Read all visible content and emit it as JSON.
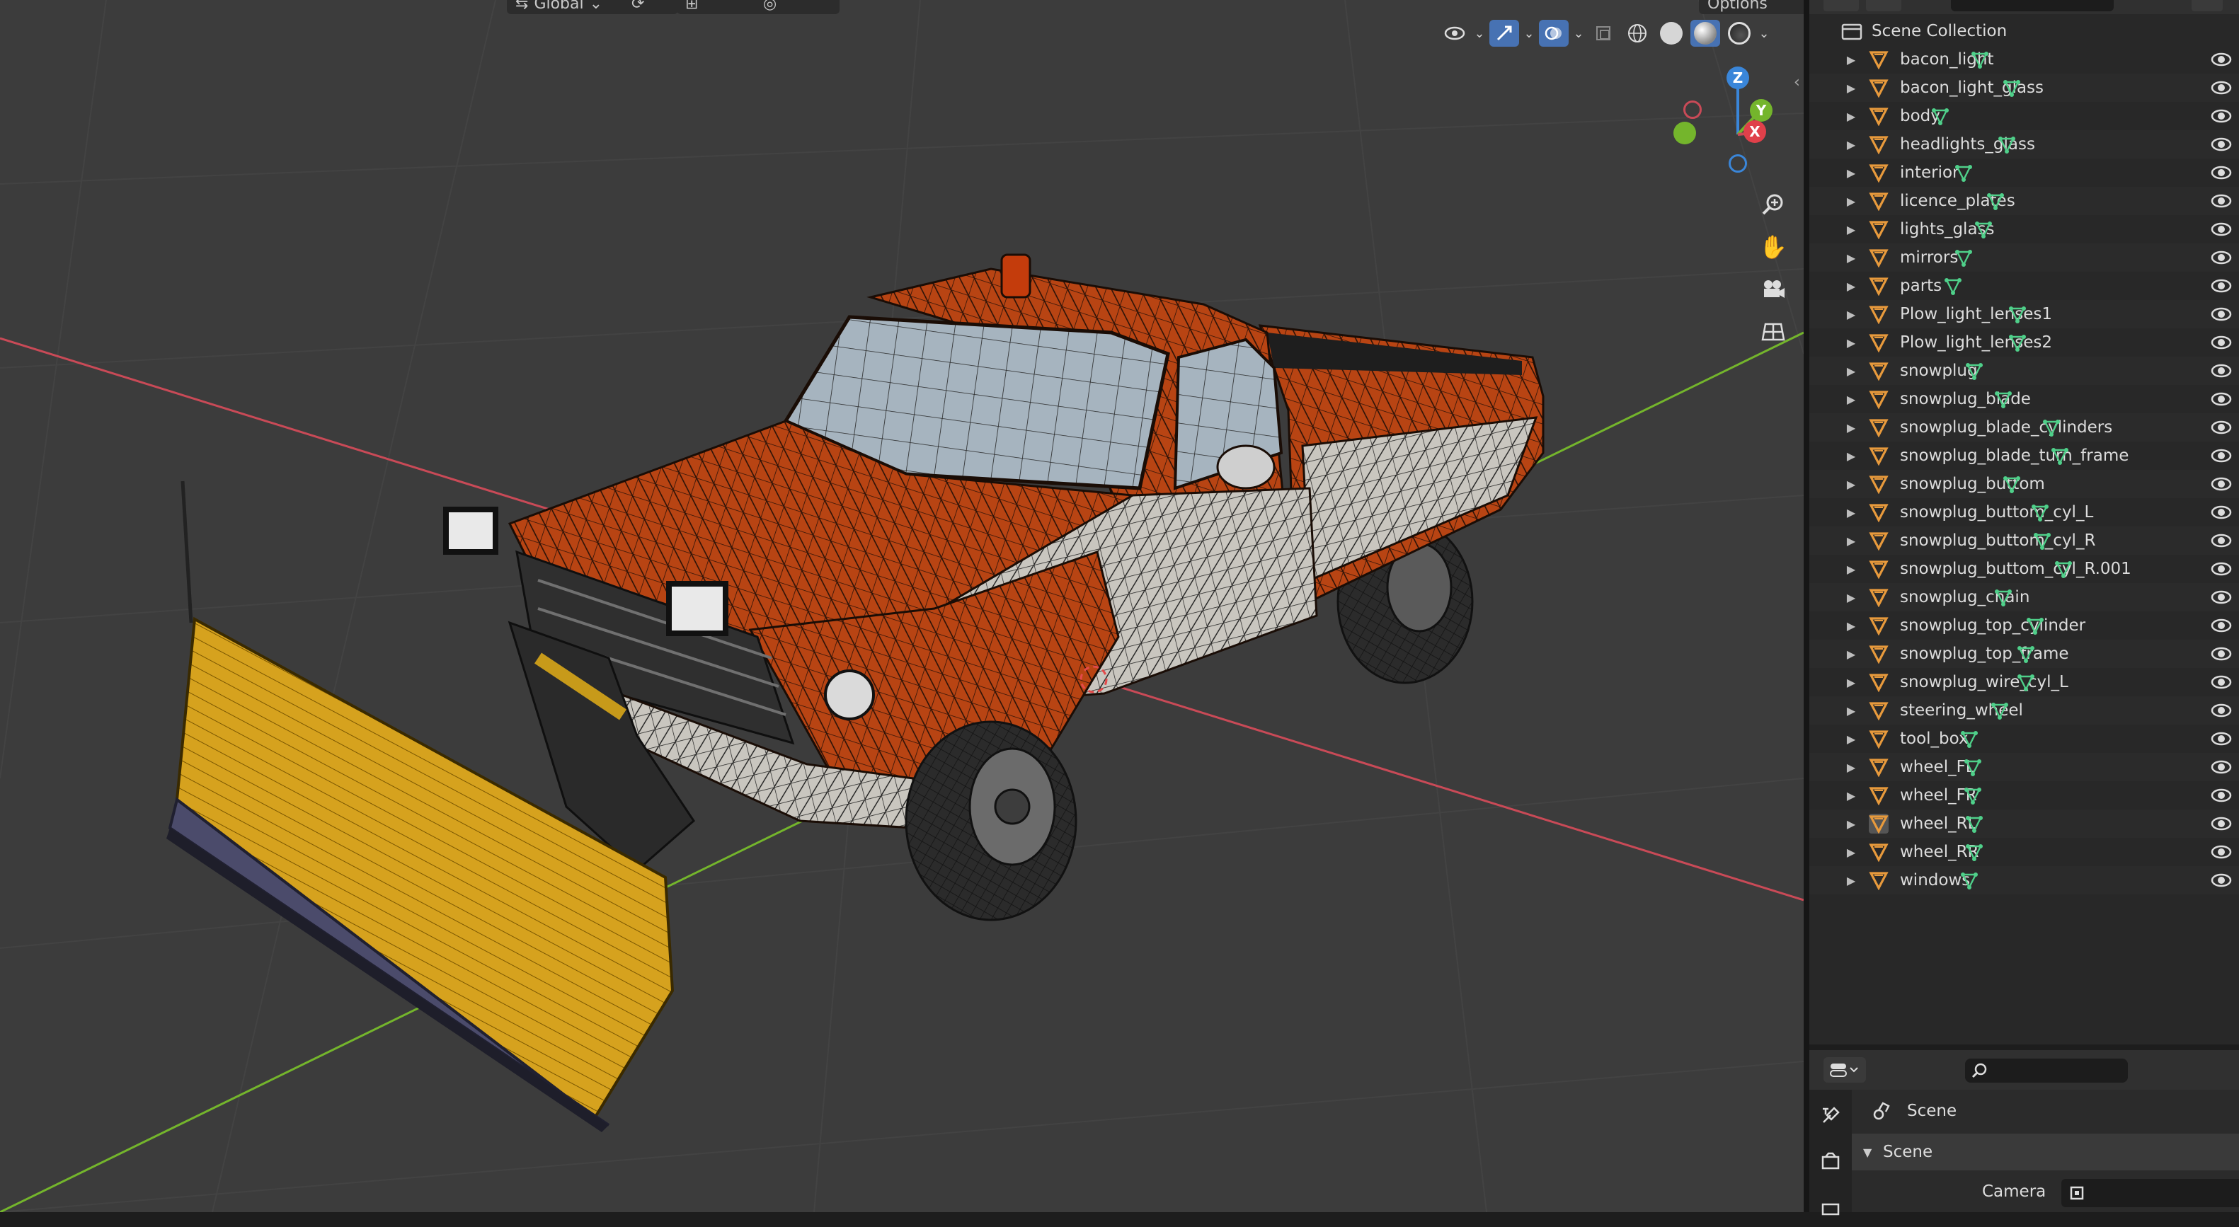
{
  "viewport": {
    "header": {
      "transform_orientation": "Global",
      "options_label": "Options"
    },
    "gizmo": {
      "z": "Z",
      "y": "Y",
      "x": "X"
    },
    "colors": {
      "background": "#3c3c3c",
      "x_axis": "#c94a57",
      "y_axis": "#74b52c",
      "z_axis": "#3a86d9",
      "body_orange": "#b84413",
      "body_white": "#c9c6bf",
      "plow_yellow": "#d6a21e",
      "wire": "#1a0d06"
    }
  },
  "outliner": {
    "root_label": "Scene Collection",
    "items": [
      {
        "label": "bacon_light"
      },
      {
        "label": "bacon_light_glass"
      },
      {
        "label": "body"
      },
      {
        "label": "headlights_glass"
      },
      {
        "label": "interior"
      },
      {
        "label": "licence_plates"
      },
      {
        "label": "lights_glass"
      },
      {
        "label": "mirrors"
      },
      {
        "label": "parts"
      },
      {
        "label": "Plow_light_lenses1"
      },
      {
        "label": "Plow_light_lenses2"
      },
      {
        "label": "snowplug"
      },
      {
        "label": "snowplug_blade"
      },
      {
        "label": "snowplug_blade_cylinders"
      },
      {
        "label": "snowplug_blade_turn_frame"
      },
      {
        "label": "snowplug_buttom"
      },
      {
        "label": "snowplug_buttom_cyl_L"
      },
      {
        "label": "snowplug_buttom_cyl_R"
      },
      {
        "label": "snowplug_buttom_cyl_R.001"
      },
      {
        "label": "snowplug_chain"
      },
      {
        "label": "snowplug_top_cylinder"
      },
      {
        "label": "snowplug_top_frame"
      },
      {
        "label": "snowplug_wire_cyl_L"
      },
      {
        "label": "steering_wheel"
      },
      {
        "label": "tool_box"
      },
      {
        "label": "wheel_FL"
      },
      {
        "label": "wheel_FR"
      },
      {
        "label": "wheel_RL"
      },
      {
        "label": "wheel_RR"
      },
      {
        "label": "windows"
      }
    ]
  },
  "properties": {
    "context_label": "Scene",
    "panel_title": "Scene",
    "camera_label": "Camera"
  }
}
